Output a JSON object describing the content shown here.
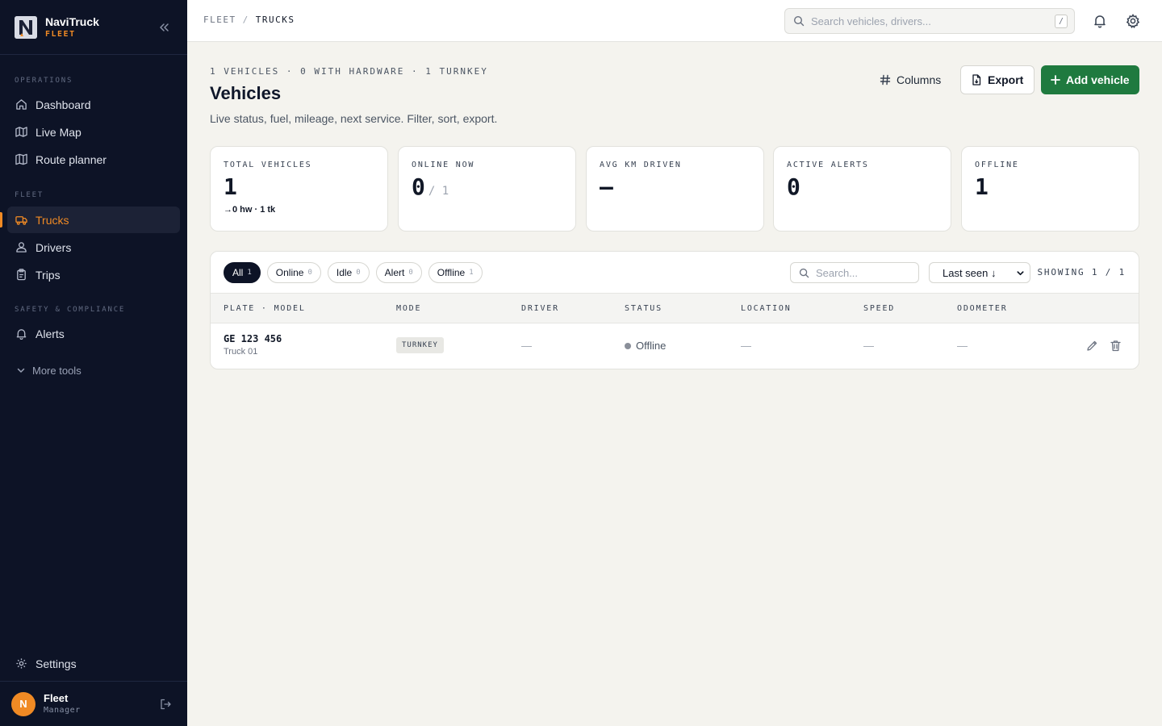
{
  "app": {
    "name": "NaviTruck",
    "sub": "FLEET",
    "logo_letter": "N"
  },
  "sidebar": {
    "sections": [
      {
        "label": "OPERATIONS",
        "items": [
          {
            "label": "Dashboard",
            "icon": "home-icon"
          },
          {
            "label": "Live Map",
            "icon": "map-icon"
          },
          {
            "label": "Route planner",
            "icon": "route-icon"
          }
        ]
      },
      {
        "label": "FLEET",
        "items": [
          {
            "label": "Trucks",
            "icon": "truck-icon",
            "active": true
          },
          {
            "label": "Drivers",
            "icon": "driver-icon"
          },
          {
            "label": "Trips",
            "icon": "clipboard-icon"
          }
        ]
      },
      {
        "label": "SAFETY & COMPLIANCE",
        "items": [
          {
            "label": "Alerts",
            "icon": "bell-icon"
          }
        ]
      }
    ],
    "more_tools": "More tools",
    "settings": "Settings",
    "user": {
      "initial": "N",
      "name": "Fleet",
      "role": "Manager"
    }
  },
  "topbar": {
    "breadcrumb": [
      "FLEET",
      "TRUCKS"
    ],
    "search_placeholder": "Search vehicles, drivers...",
    "search_shortcut": "/"
  },
  "page": {
    "meta": "1 VEHICLES · 0 WITH HARDWARE · 1 TURNKEY",
    "title": "Vehicles",
    "subtitle": "Live status, fuel, mileage, next service. Filter, sort, export.",
    "buttons": {
      "columns": "Columns",
      "export": "Export",
      "add": "Add vehicle"
    }
  },
  "kpis": [
    {
      "label": "TOTAL VEHICLES",
      "value": "1",
      "note": "→0 hw · 1 tk"
    },
    {
      "label": "ONLINE NOW",
      "value": "0",
      "of": "/ 1"
    },
    {
      "label": "AVG KM DRIVEN",
      "value": "—"
    },
    {
      "label": "ACTIVE ALERTS",
      "value": "0"
    },
    {
      "label": "OFFLINE",
      "value": "1"
    }
  ],
  "filters": [
    {
      "label": "All",
      "count": "1",
      "active": true
    },
    {
      "label": "Online",
      "count": "0"
    },
    {
      "label": "Idle",
      "count": "0"
    },
    {
      "label": "Alert",
      "count": "0"
    },
    {
      "label": "Offline",
      "count": "1"
    }
  ],
  "table": {
    "search_placeholder": "Search...",
    "sort_value": "Last seen ↓",
    "showing": "SHOWING 1 / 1",
    "columns": [
      "PLATE · MODEL",
      "MODE",
      "DRIVER",
      "STATUS",
      "LOCATION",
      "SPEED",
      "ODOMETER"
    ],
    "rows": [
      {
        "plate": "GE 123 456",
        "model": "Truck 01",
        "mode": "TURNKEY",
        "driver": "—",
        "status": "Offline",
        "location": "—",
        "speed": "—",
        "odometer": "—"
      }
    ]
  },
  "colors": {
    "accent": "#f08a24",
    "sidebar_bg": "#0d1326",
    "primary_button": "#1f7a3f",
    "offline_dot": "#8a8f99"
  }
}
